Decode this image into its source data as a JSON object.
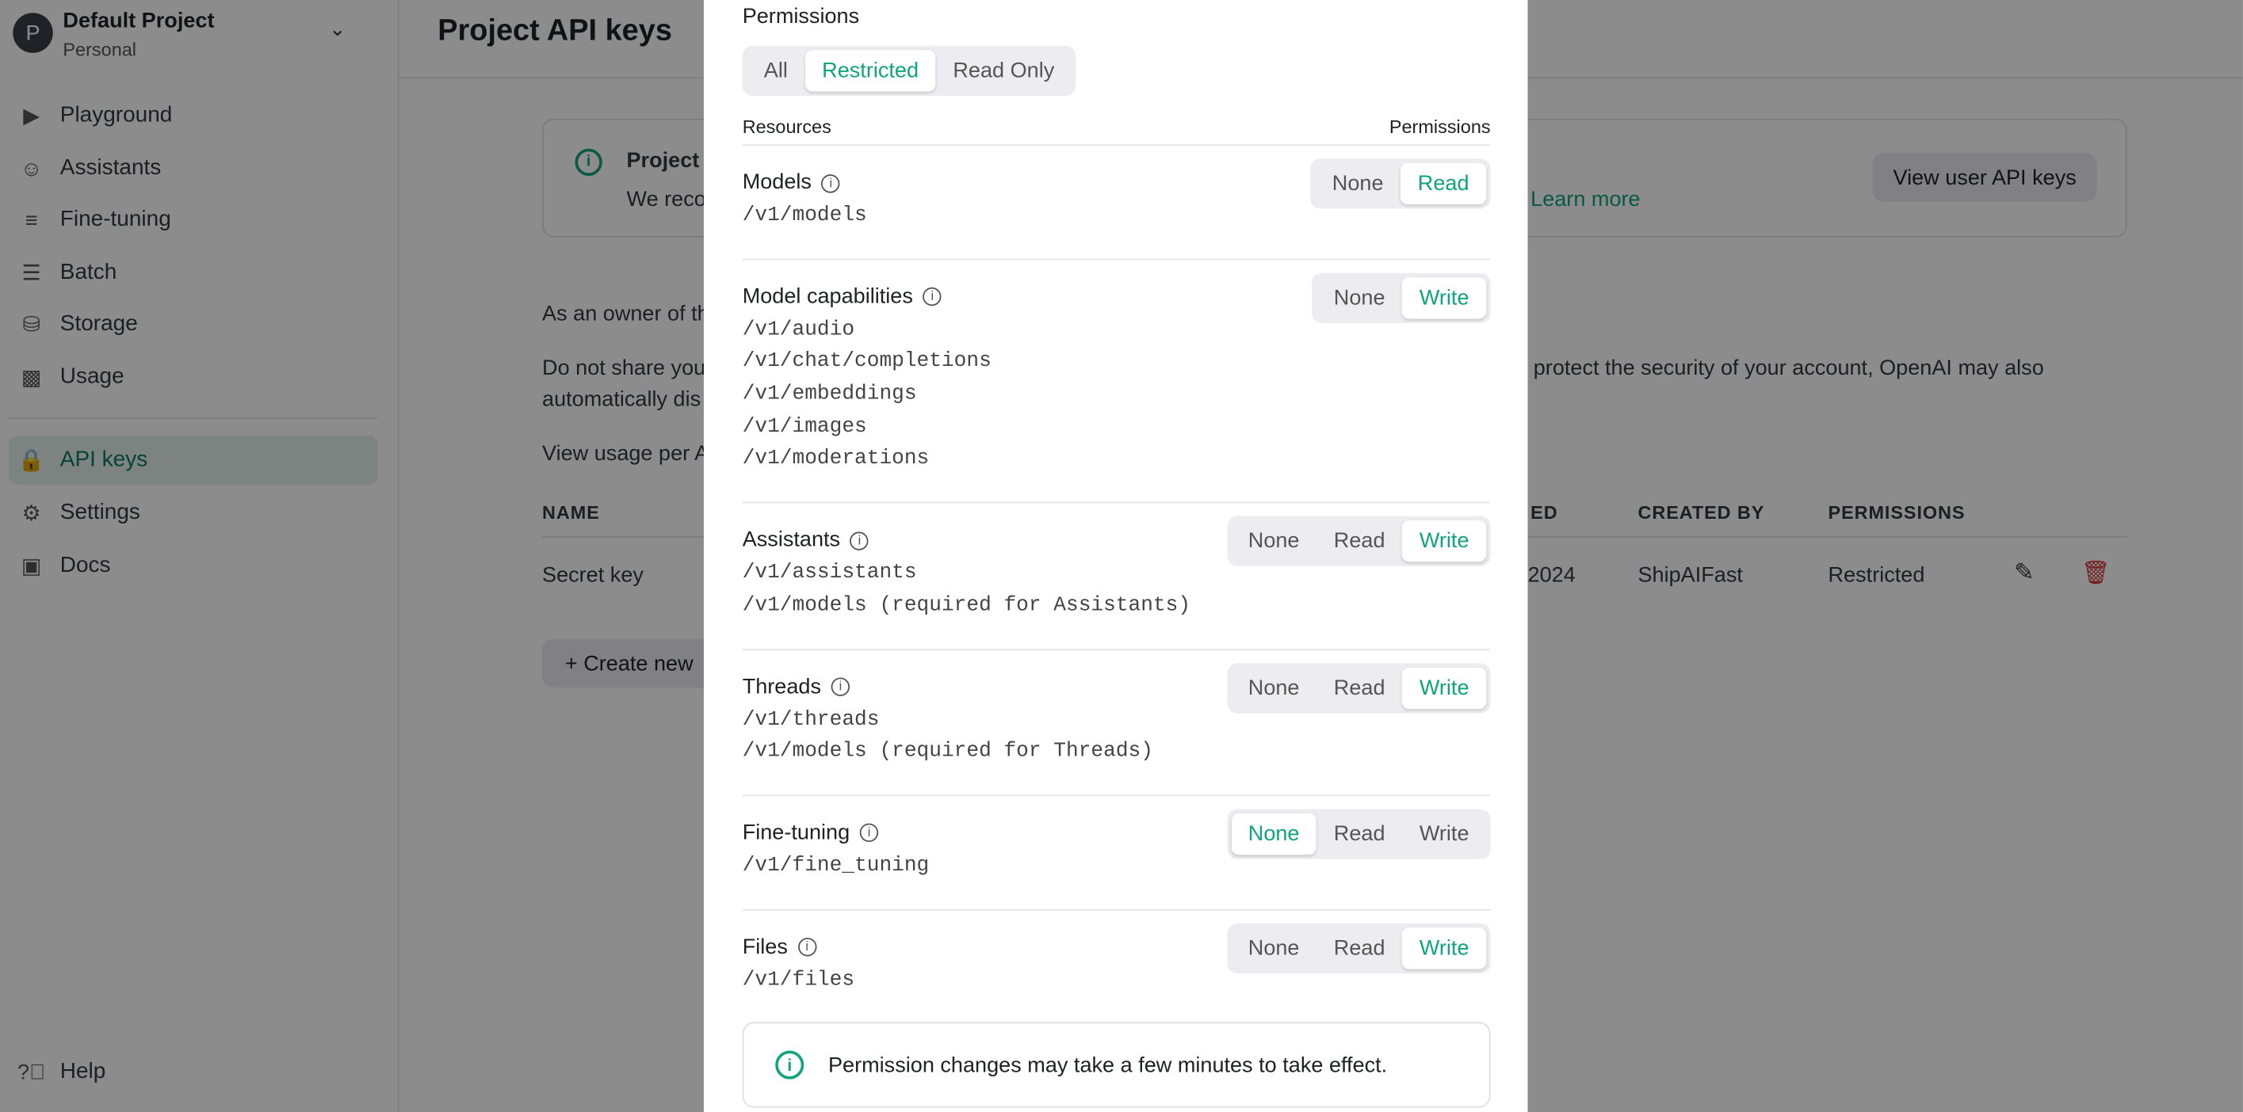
{
  "sidebar": {
    "project": {
      "initial": "P",
      "name": "Default Project",
      "type": "Personal"
    },
    "items": [
      {
        "label": "Playground",
        "icon": "terminal-icon"
      },
      {
        "label": "Assistants",
        "icon": "robot-icon"
      },
      {
        "label": "Fine-tuning",
        "icon": "sliders-icon"
      },
      {
        "label": "Batch",
        "icon": "stack-icon"
      },
      {
        "label": "Storage",
        "icon": "database-icon"
      },
      {
        "label": "Usage",
        "icon": "bar-chart-icon"
      },
      {
        "label": "API keys",
        "icon": "lock-icon",
        "selected": true
      },
      {
        "label": "Settings",
        "icon": "gear-icon"
      },
      {
        "label": "Docs",
        "icon": "book-icon"
      }
    ],
    "help": "Help"
  },
  "main": {
    "title": "Project API keys",
    "banner": {
      "title": "Project ",
      "text": "We reco",
      "link": "Learn more",
      "button": "View user API keys"
    },
    "para1": "As an owner of th",
    "para2a": "Do not share you",
    "para2b": "protect the security of your account, OpenAI may also",
    "para2c": "automatically dis",
    "para3": "View usage per A",
    "table": {
      "headers": [
        "NAME",
        "ED",
        "CREATED BY",
        "PERMISSIONS"
      ],
      "row": {
        "name": "Secret key",
        "date": "2024",
        "created_by": "ShipAIFast",
        "permissions": "Restricted"
      }
    },
    "create_button": "+ Create new"
  },
  "modal": {
    "permissions_label": "Permissions",
    "mode_options": [
      "All",
      "Restricted",
      "Read Only"
    ],
    "mode_selected": "Restricted",
    "col_resources": "Resources",
    "col_permissions": "Permissions",
    "resources": [
      {
        "name": "Models",
        "endpoints": [
          "/v1/models"
        ],
        "options": [
          "None",
          "Read"
        ],
        "selected": "Read"
      },
      {
        "name": "Model capabilities",
        "endpoints": [
          "/v1/audio",
          "/v1/chat/completions",
          "/v1/embeddings",
          "/v1/images",
          "/v1/moderations"
        ],
        "options": [
          "None",
          "Write"
        ],
        "selected": "Write"
      },
      {
        "name": "Assistants",
        "endpoints": [
          "/v1/assistants",
          "/v1/models (required for Assistants)"
        ],
        "options": [
          "None",
          "Read",
          "Write"
        ],
        "selected": "Write"
      },
      {
        "name": "Threads",
        "endpoints": [
          "/v1/threads",
          "/v1/models (required for Threads)"
        ],
        "options": [
          "None",
          "Read",
          "Write"
        ],
        "selected": "Write"
      },
      {
        "name": "Fine-tuning",
        "endpoints": [
          "/v1/fine_tuning"
        ],
        "options": [
          "None",
          "Read",
          "Write"
        ],
        "selected": "None"
      },
      {
        "name": "Files",
        "endpoints": [
          "/v1/files"
        ],
        "options": [
          "None",
          "Read",
          "Write"
        ],
        "selected": "Write"
      }
    ],
    "notice": "Permission changes may take a few minutes to take effect."
  },
  "colors": {
    "accent": "#10a37f",
    "danger": "#d32f2f",
    "overlay": "rgba(0,0,0,0.45)"
  }
}
